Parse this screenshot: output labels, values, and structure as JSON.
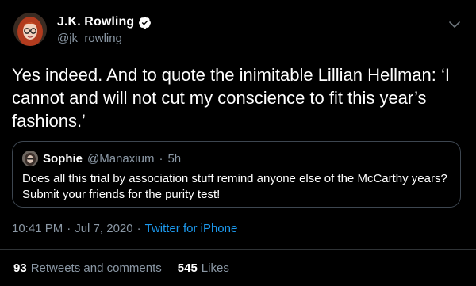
{
  "author": {
    "display_name": "J.K. Rowling",
    "handle": "@jk_rowling",
    "verified": true,
    "avatar_icon": "profile-photo-red-hair-glasses"
  },
  "tweet": {
    "text": "Yes indeed. And to quote the inimitable Lillian Hellman: ‘I cannot and will not cut my conscience to fit this year’s fashions.’",
    "menu_icon": "chevron-down-icon"
  },
  "quoted_tweet": {
    "display_name": "Sophie",
    "handle": "@Manaxium",
    "separator": "·",
    "time": "5h",
    "text": "Does all this trial by association stuff remind anyone else of the McCarthy years? Submit your friends for the purity test!",
    "avatar_icon": "profile-photo"
  },
  "meta": {
    "time": "10:41 PM",
    "separator1": "·",
    "date": "Jul 7, 2020",
    "separator2": "·",
    "source": "Twitter for iPhone"
  },
  "stats": {
    "retweets_count": "93",
    "retweets_label": "Retweets and comments",
    "likes_count": "545",
    "likes_label": "Likes"
  },
  "colors": {
    "background": "#000000",
    "primary_text": "#ffffff",
    "secondary_text": "#8b98a5",
    "link": "#1d9bf0",
    "verified_badge": "#ffffff",
    "border": "#3d4650"
  }
}
